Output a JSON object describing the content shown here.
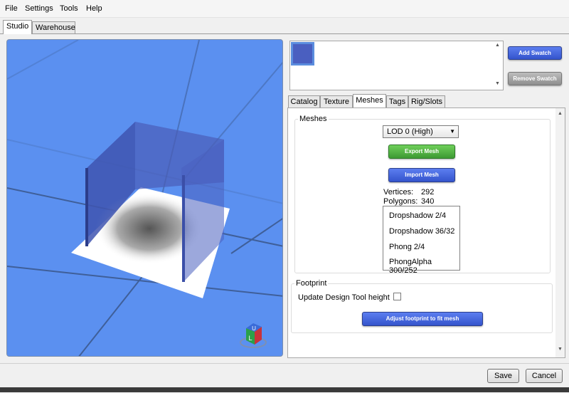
{
  "menu": {
    "items": [
      "File",
      "Settings",
      "Tools",
      "Help"
    ]
  },
  "outer_tabs": [
    "Studio",
    "Warehouse"
  ],
  "swatch": {
    "add_label": "Add Swatch",
    "remove_label": "Remove Swatch",
    "chip_color": "#4a5fc0"
  },
  "inner_tabs": [
    "Catalog",
    "Texture",
    "Meshes",
    "Tags",
    "Rig/Slots"
  ],
  "meshes": {
    "group_title": "Meshes",
    "lod_selected": "LOD 0 (High)",
    "export_label": "Export Mesh",
    "import_label": "Import Mesh",
    "vertices_label": "Vertices:",
    "vertices_value": "292",
    "polygons_label": "Polygons:",
    "polygons_value": "340",
    "shaders": [
      "Dropshadow 2/4",
      "Dropshadow 36/32",
      "Phong 2/4",
      "PhongAlpha 300/252"
    ]
  },
  "footprint": {
    "group_title": "Footprint",
    "checkbox_label": "Update Design Tool height",
    "checkbox_checked": false,
    "adjust_label": "Adjust footprint to fit mesh"
  },
  "gizmo": {
    "top_letter": "U",
    "front_letter": "L"
  },
  "footer": {
    "save_label": "Save",
    "cancel_label": "Cancel"
  }
}
